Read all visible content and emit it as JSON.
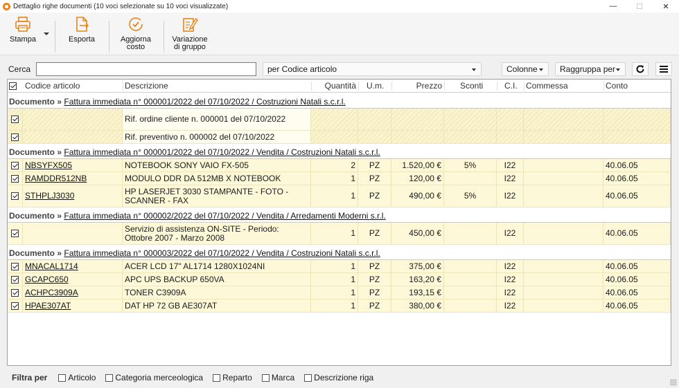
{
  "window": {
    "title": "Dettaglio righe documenti (10 voci selezionate su 10 voci visualizzate)",
    "minimize": "—",
    "maximize": "☐",
    "close": "✕"
  },
  "toolbar": {
    "stampa": "Stampa",
    "esporta": "Esporta",
    "aggiorna_1": "Aggiorna",
    "aggiorna_2": "costo",
    "variazione_1": "Variazione",
    "variazione_2": "di gruppo"
  },
  "search": {
    "label": "Cerca",
    "value": "",
    "field": "per Codice articolo",
    "colonne": "Colonne",
    "raggruppa": "Raggruppa per"
  },
  "columns": {
    "codice": "Codice articolo",
    "descrizione": "Descrizione",
    "quantita": "Quantità",
    "um": "U.m.",
    "prezzo": "Prezzo",
    "sconti": "Sconti",
    "ci": "C.I.",
    "commessa": "Commessa",
    "conto": "Conto"
  },
  "group_key": "Documento",
  "group_sep": "»",
  "groups": [
    {
      "title": "Fattura immediata n° 000001/2022 del 07/10/2022 / Costruzioni Natali s.c.r.l.",
      "rows": [
        {
          "checked": true,
          "codice": "",
          "descrizione": "Rif. ordine cliente n. 000001 del 07/10/2022",
          "quantita": "",
          "um": "",
          "prezzo": "",
          "sconti": "",
          "ci": "",
          "commessa": "",
          "conto": ""
        },
        {
          "checked": true,
          "codice": "",
          "descrizione": "Rif. preventivo n. 000002 del 07/10/2022",
          "quantita": "",
          "um": "",
          "prezzo": "",
          "sconti": "",
          "ci": "",
          "commessa": "",
          "conto": ""
        }
      ]
    },
    {
      "title": "Fattura immediata n° 000001/2022 del 07/10/2022 / Vendita / Costruzioni Natali s.c.r.l.",
      "rows": [
        {
          "checked": true,
          "codice": "NBSYFX505",
          "descrizione": "NOTEBOOK SONY VAIO FX-505",
          "quantita": "2",
          "um": "PZ",
          "prezzo": "1.520,00 €",
          "sconti": "5%",
          "ci": "I22",
          "commessa": "",
          "conto": "40.06.05"
        },
        {
          "checked": true,
          "codice": "RAMDDR512NB",
          "descrizione": "MODULO DDR DA 512MB  X NOTEBOOK",
          "quantita": "1",
          "um": "PZ",
          "prezzo": "120,00 €",
          "sconti": "",
          "ci": "I22",
          "commessa": "",
          "conto": "40.06.05"
        },
        {
          "checked": true,
          "codice": "STHPLJ3030",
          "descrizione": "HP LASERJET 3030 STAMPANTE - FOTO - SCANNER - FAX",
          "quantita": "1",
          "um": "PZ",
          "prezzo": "490,00 €",
          "sconti": "5%",
          "ci": "I22",
          "commessa": "",
          "conto": "40.06.05"
        }
      ]
    },
    {
      "title": "Fattura immediata n° 000002/2022 del 07/10/2022 / Vendita / Arredamenti Moderni s.r.l.",
      "rows": [
        {
          "checked": true,
          "codice": "",
          "descrizione": "Servizio di assistenza ON-SITE - Periodo: Ottobre 2007 - Marzo 2008",
          "quantita": "1",
          "um": "PZ",
          "prezzo": "450,00 €",
          "sconti": "",
          "ci": "I22",
          "commessa": "",
          "conto": "40.06.05"
        }
      ]
    },
    {
      "title": "Fattura immediata n° 000003/2022 del 07/10/2022 / Vendita / Costruzioni Natali s.c.r.l.",
      "rows": [
        {
          "checked": true,
          "codice": "MNACAL1714",
          "descrizione": "ACER LCD 17\" AL1714 1280X1024NI",
          "quantita": "1",
          "um": "PZ",
          "prezzo": "375,00 €",
          "sconti": "",
          "ci": "I22",
          "commessa": "",
          "conto": "40.06.05"
        },
        {
          "checked": true,
          "codice": "GCAPC650",
          "descrizione": "APC UPS BACKUP 650VA",
          "quantita": "1",
          "um": "PZ",
          "prezzo": "163,20 €",
          "sconti": "",
          "ci": "I22",
          "commessa": "",
          "conto": "40.06.05"
        },
        {
          "checked": true,
          "codice": "ACHPC3909A",
          "descrizione": "TONER C3909A",
          "quantita": "1",
          "um": "PZ",
          "prezzo": "193,15 €",
          "sconti": "",
          "ci": "I22",
          "commessa": "",
          "conto": "40.06.05"
        },
        {
          "checked": true,
          "codice": "HPAE307AT",
          "descrizione": "DAT HP 72 GB AE307AT",
          "quantita": "1",
          "um": "PZ",
          "prezzo": "380,00 €",
          "sconti": "",
          "ci": "I22",
          "commessa": "",
          "conto": "40.06.05"
        }
      ]
    }
  ],
  "filter": {
    "label": "Filtra per",
    "options": [
      "Articolo",
      "Categoria merceologica",
      "Reparto",
      "Marca",
      "Descrizione riga"
    ]
  },
  "colors": {
    "row_bg": "#fdf8d8",
    "accent_icon": "#e8841a"
  }
}
